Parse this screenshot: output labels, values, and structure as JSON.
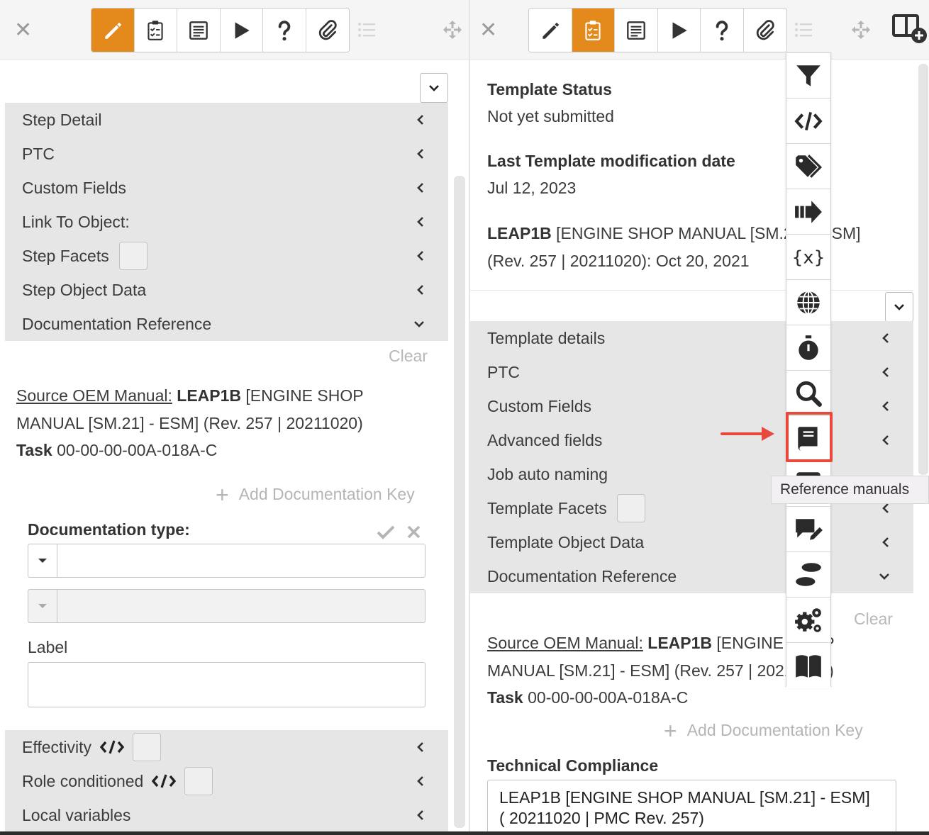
{
  "left": {
    "close_glyph": "✕",
    "sections": [
      {
        "label": "Step Detail"
      },
      {
        "label": "PTC"
      },
      {
        "label": "Custom Fields"
      },
      {
        "label": "Link To Object:"
      },
      {
        "label": "Step Facets"
      },
      {
        "label": "Step Object Data"
      },
      {
        "label": "Documentation Reference"
      }
    ],
    "clear_label": "Clear",
    "doc": {
      "source_label": "Source OEM Manual:",
      "manual_name": "LEAP1B",
      "manual_rest_1": " [ENGINE SHOP",
      "manual_rest_2": "MANUAL [SM.21] - ESM] (Rev. 257 | 20211020)",
      "task_label": "Task",
      "task_value": " 00-00-00-00A-018A-C"
    },
    "add_key_label": "Add Documentation Key",
    "doc_type_label": "Documentation type:",
    "label_label": "Label",
    "footer_sections": [
      {
        "label": "Effectivity"
      },
      {
        "label": "Role conditioned"
      },
      {
        "label": "Local variables"
      }
    ]
  },
  "right": {
    "close_glyph": "✕",
    "template_status_title": "Template Status",
    "template_status_value": "Not yet submitted",
    "last_mod_title": "Last Template modification date",
    "last_mod_value": "Jul 12, 2023",
    "manual_line_bold": "LEAP1B",
    "manual_line_1": " [ENGINE SHOP MANUAL [SM.21] - ESM]",
    "manual_line_2": "(Rev. 257 | 20211020): Oct 20, 2021",
    "sections": [
      {
        "label": "Template details"
      },
      {
        "label": "PTC"
      },
      {
        "label": "Custom Fields"
      },
      {
        "label": "Advanced fields"
      },
      {
        "label": "Job auto naming"
      },
      {
        "label": "Template Facets"
      },
      {
        "label": "Template Object Data"
      },
      {
        "label": "Documentation Reference"
      }
    ],
    "clear_label": "Clear",
    "doc": {
      "source_label": "Source OEM Manual:",
      "manual_name": "LEAP1B",
      "manual_rest_1": " [ENGINE SHOP",
      "manual_rest_2": "MANUAL [SM.21] - ESM] (Rev. 257 | 20211020)",
      "task_label": "Task",
      "task_value": " 00-00-00-00A-018A-C"
    },
    "add_key_label": "Add Documentation Key",
    "tech_compliance_title": "Technical Compliance",
    "tech_compliance_line_1": "LEAP1B [ENGINE SHOP MANUAL [SM.21] - ESM]",
    "tech_compliance_line_2": "( 20211020 | PMC Rev. 257)"
  },
  "tooltip": "Reference manuals",
  "colors": {
    "accent": "#e48a1c",
    "highlight": "#e9493c",
    "section_bg": "#e6e6e6"
  },
  "vertical_toolbar_icons": [
    "filter-icon",
    "code-icon",
    "tags-icon",
    "forward-icon",
    "variable-icon",
    "globe-icon",
    "stopwatch-icon",
    "search-icon",
    "book-icon",
    "plus-icon",
    "comment-edit-icon",
    "footprints-icon",
    "gears-icon",
    "open-book-icon"
  ]
}
